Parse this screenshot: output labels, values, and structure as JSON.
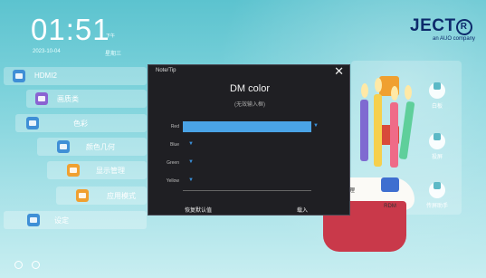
{
  "status": {
    "time": "01:51",
    "ampm": "下午",
    "date": "2023-10-04",
    "weekday": "星期三"
  },
  "brand": {
    "name": "JECT",
    "mark": "R",
    "tagline": "an AUO company"
  },
  "menu": [
    {
      "label": "HDMI2",
      "icon": "hdmi-icon",
      "color": "#3f8fd6"
    },
    {
      "label": "画质类",
      "icon": "picture-icon",
      "color": "#8a63d2"
    },
    {
      "label": "色彩",
      "icon": "color-icon",
      "color": "#3f8fd6"
    },
    {
      "label": "颜色几何",
      "icon": "geometry-icon",
      "color": "#3f8fd6"
    },
    {
      "label": "显示管理",
      "icon": "display-icon",
      "color": "#f0a030"
    },
    {
      "label": "应用模式",
      "icon": "mode-icon",
      "color": "#f0a030"
    },
    {
      "label": "设定",
      "icon": "settings-icon",
      "color": "#3f8fd6"
    }
  ],
  "apps": [
    {
      "label": "白板",
      "icon": "whiteboard-icon"
    },
    {
      "label": "投屏",
      "icon": "cast-icon"
    },
    {
      "label": "文件管理",
      "icon": "folder-icon"
    },
    {
      "label": "RDM",
      "icon": "rdm-icon"
    },
    {
      "label": "传屏助手",
      "icon": "share-icon"
    }
  ],
  "dialog": {
    "title": "Note/Tip",
    "close": "✕",
    "heading": "DM color",
    "subtitle": "(无效输入框)",
    "fields": [
      {
        "label": "Red",
        "arrow": "▼"
      },
      {
        "label": "Blue",
        "arrow": "▼"
      },
      {
        "label": "Green",
        "arrow": "▼"
      },
      {
        "label": "Yellow",
        "arrow": "▼"
      }
    ],
    "buttons": {
      "reset": "恢复默认值",
      "confirm": "载入"
    }
  },
  "colors": {
    "accent": "#4aa3e6",
    "dialog_bg": "#1f1f23",
    "cake_red": "#c9394a"
  }
}
